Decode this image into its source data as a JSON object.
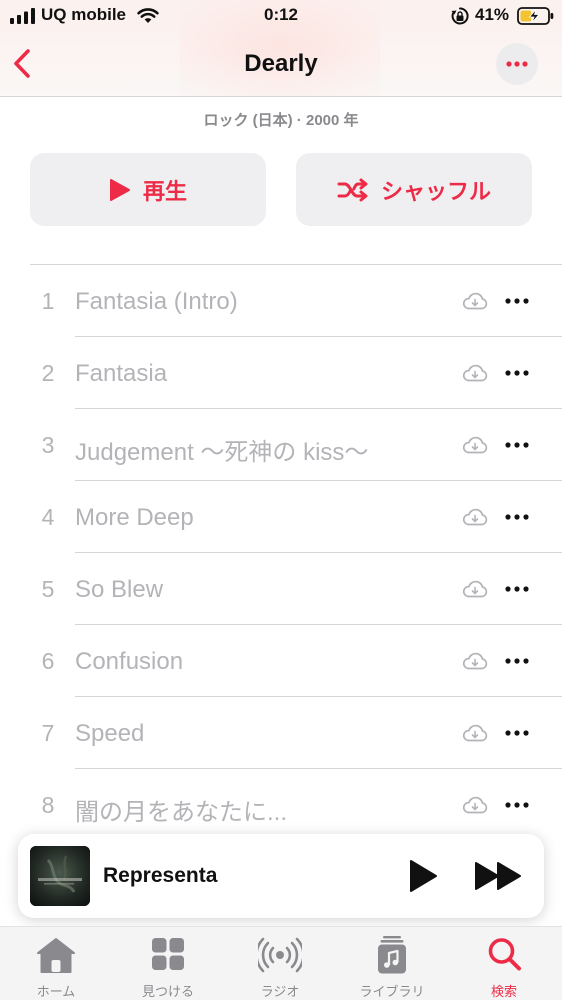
{
  "status_bar": {
    "carrier": "UQ mobile",
    "time": "0:12",
    "battery": "41%",
    "battery_level": 0.41
  },
  "nav": {
    "title": "Dearly",
    "back_icon": "chevron-left-icon",
    "more_icon": "ellipsis-icon"
  },
  "album": {
    "meta": "ロック (日本) · 2000 年"
  },
  "actions": {
    "play_label": "再生",
    "shuffle_label": "シャッフル"
  },
  "tracks": [
    {
      "number": "1",
      "title": "Fantasia (Intro)"
    },
    {
      "number": "2",
      "title": "Fantasia"
    },
    {
      "number": "3",
      "title": "Judgement 〜死神の kiss〜"
    },
    {
      "number": "4",
      "title": "More Deep"
    },
    {
      "number": "5",
      "title": "So Blew"
    },
    {
      "number": "6",
      "title": "Confusion"
    },
    {
      "number": "7",
      "title": "Speed"
    },
    {
      "number": "8",
      "title": "闇の月をあなたに..."
    }
  ],
  "mini_player": {
    "title": "Representa"
  },
  "tab_bar": {
    "tabs": [
      {
        "label": "ホーム",
        "icon": "home-icon"
      },
      {
        "label": "見つける",
        "icon": "grid-icon"
      },
      {
        "label": "ラジオ",
        "icon": "radio-icon"
      },
      {
        "label": "ライブラリ",
        "icon": "library-icon"
      },
      {
        "label": "検索",
        "icon": "search-icon"
      }
    ],
    "active": "検索"
  },
  "colors": {
    "accent": "#ee2b47",
    "muted_text": "#b4b4b8",
    "button_bg": "#efeff1"
  }
}
